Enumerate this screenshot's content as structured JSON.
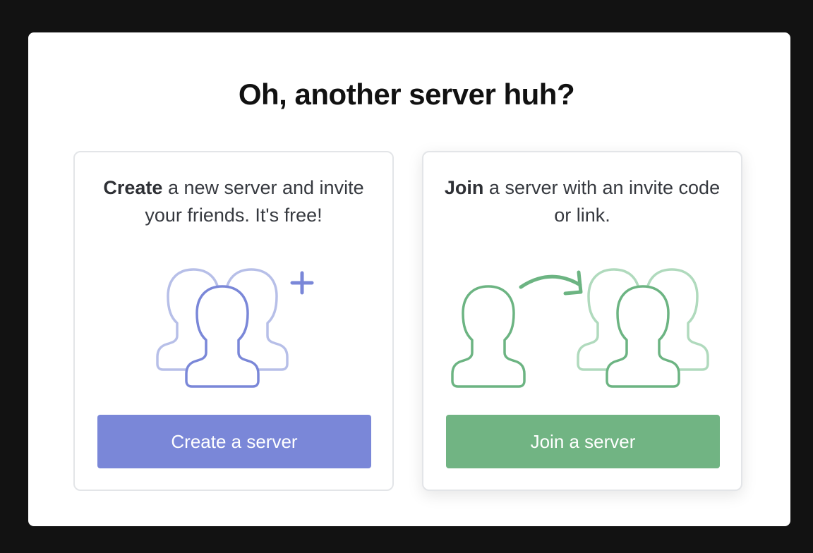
{
  "modal": {
    "title": "Oh, another server huh?"
  },
  "create": {
    "desc_bold": "Create",
    "desc_rest": " a new server and invite your friends. It's free!",
    "button_label": "Create a server",
    "illustration": "create-server-illustration",
    "colors": {
      "primary": "#7a87d8",
      "faded": "#b7bfe8"
    }
  },
  "join": {
    "desc_bold": "Join",
    "desc_rest": " a server with an invite code or link.",
    "button_label": "Join a server",
    "illustration": "join-server-illustration",
    "colors": {
      "primary": "#6cb482",
      "faded": "#b0dabd"
    }
  },
  "colors": {
    "backdrop": "#121212",
    "modal": "#ffffff",
    "card_border": "#e3e5e8",
    "title": "#111111",
    "text": "#36393f"
  }
}
